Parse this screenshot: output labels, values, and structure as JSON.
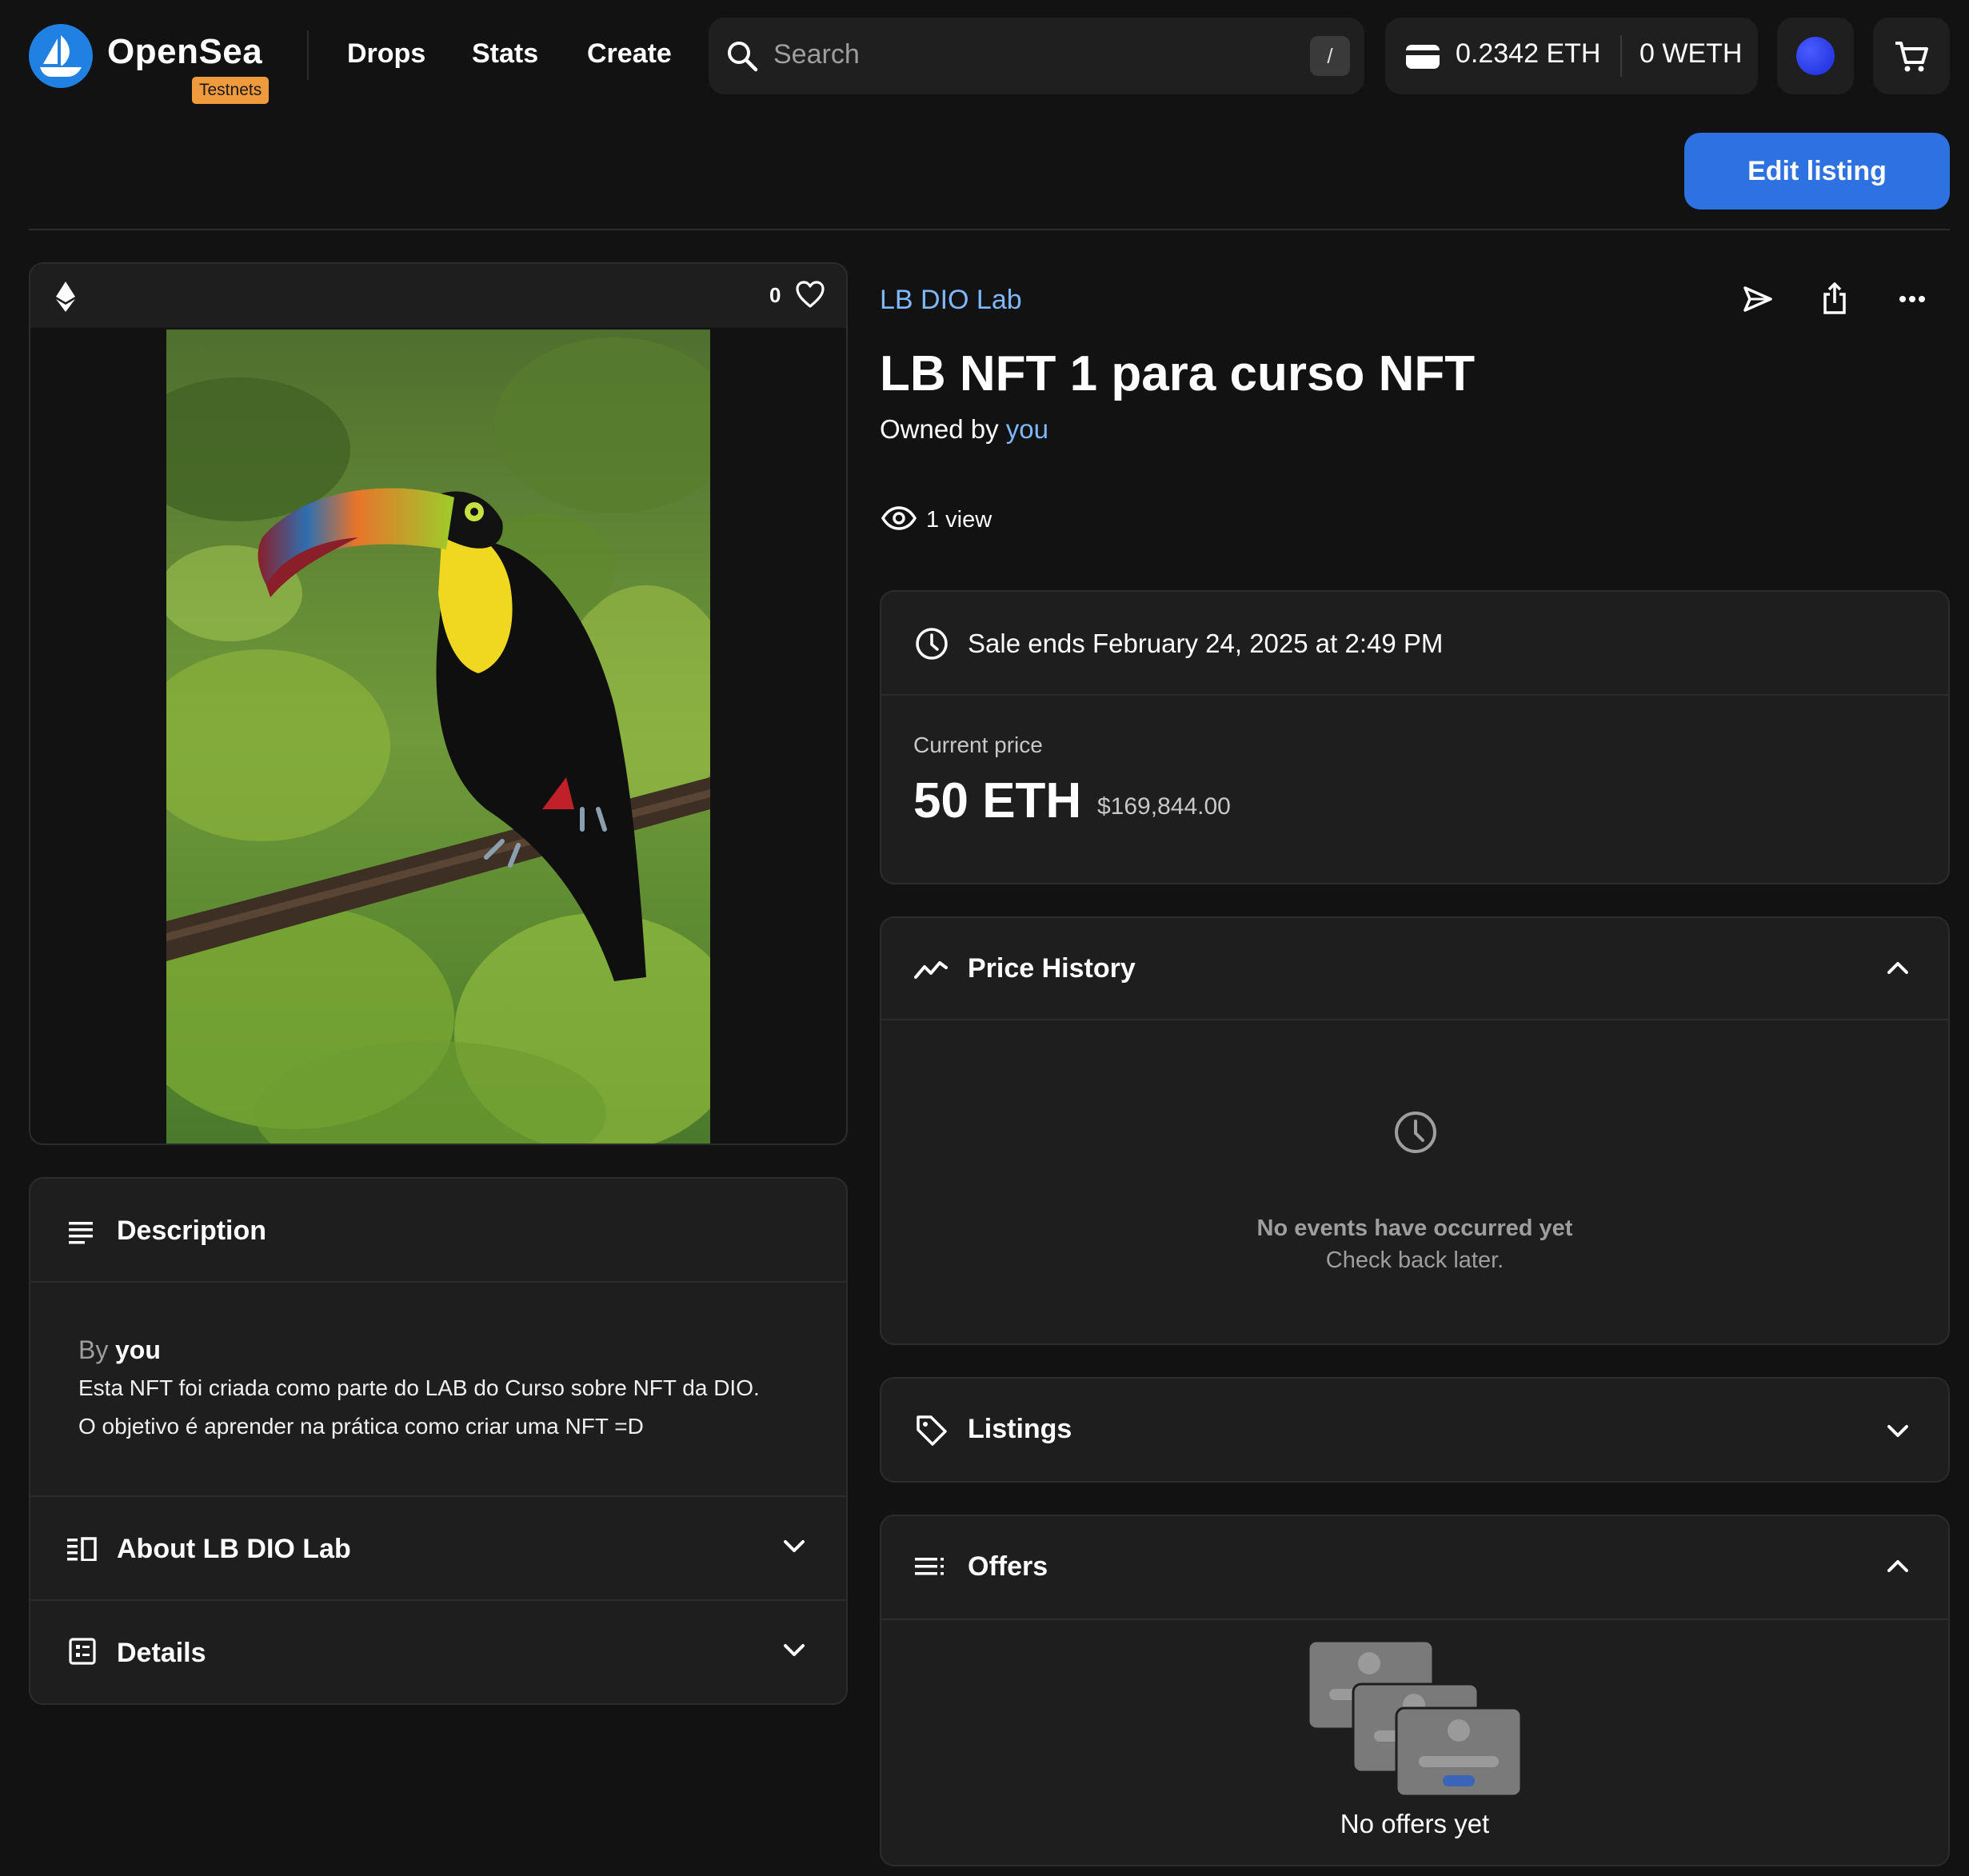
{
  "header": {
    "brand": "OpenSea",
    "badge": "Testnets",
    "nav": [
      "Drops",
      "Stats",
      "Create"
    ],
    "search_placeholder": "Search",
    "search_shortcut": "/",
    "wallet": {
      "eth_balance": "0.2342 ETH",
      "weth_balance": "0 WETH"
    },
    "edit_listing_label": "Edit listing"
  },
  "asset": {
    "favorite_count": "0",
    "image_description_icon": "toucan-image",
    "collection": "LB DIO Lab",
    "title": "LB NFT 1 para curso NFT",
    "owned_by_prefix": "Owned by",
    "owner": "you",
    "views": "1 view"
  },
  "description": {
    "title": "Description",
    "by_prefix": "By",
    "by_author": "you",
    "lines": [
      "Esta NFT foi criada como parte do LAB do Curso sobre NFT da DIO.",
      "O objetivo é aprender na prática como criar uma NFT =D"
    ],
    "about_title": "About LB DIO Lab",
    "details_title": "Details"
  },
  "sale": {
    "ends_text": "Sale ends February 24, 2025 at 2:49 PM",
    "current_price_label": "Current price",
    "price_eth": "50 ETH",
    "price_usd": "$169,844.00"
  },
  "price_history": {
    "title": "Price History",
    "empty_title": "No events have occurred yet",
    "empty_sub": "Check back later."
  },
  "listings": {
    "title": "Listings"
  },
  "offers": {
    "title": "Offers",
    "empty_text": "No offers yet"
  },
  "colors": {
    "background": "#121212",
    "panel": "#1e1e1e",
    "accent_blue": "#2e71e0",
    "link_blue": "#7eb8ff",
    "testnets_badge": "#f09a3e"
  }
}
